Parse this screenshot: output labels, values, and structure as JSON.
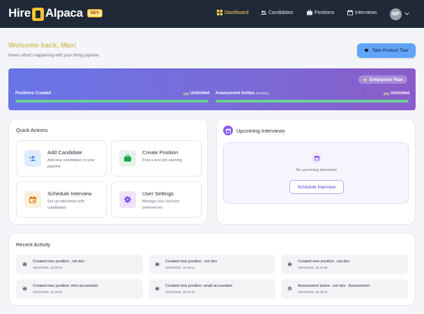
{
  "nav": {
    "logo_left": "Hire",
    "logo_right": "Alpaca",
    "env_badge": "DEV",
    "items": [
      {
        "label": "Dashboard",
        "icon": "dashboard-icon",
        "active": true
      },
      {
        "label": "Candidates",
        "icon": "users-icon",
        "active": false
      },
      {
        "label": "Positions",
        "icon": "briefcase-icon",
        "active": false
      },
      {
        "label": "Interviews",
        "icon": "calendar-icon",
        "active": false
      }
    ],
    "user_initials": "MP"
  },
  "header": {
    "welcome": "Welcome back, Max!",
    "subtitle": "Here's what's happening with your hiring pipeline",
    "tour_button": "Take Product Tour"
  },
  "usage": {
    "plan": "Enterprise Plan",
    "positions_label": "Positions Created",
    "positions_value": "Unlimited",
    "positions_fill": 1.0,
    "invites_label": "Assessment Invites",
    "invites_period": "(Monthly)",
    "invites_value": "Unlimited",
    "invites_fill": 1.0
  },
  "quick_actions": {
    "title": "Quick Actions",
    "items": [
      {
        "title": "Add Candidate",
        "desc": "Add new candidates to your pipeline",
        "icon": "add-user-icon"
      },
      {
        "title": "Create Position",
        "desc": "Post a new job opening",
        "icon": "briefcase-icon"
      },
      {
        "title": "Schedule Interview",
        "desc": "Set up interviews with candidates",
        "icon": "calendar-icon"
      },
      {
        "title": "User Settings",
        "desc": "Manage your account preferences",
        "icon": "gear-icon"
      }
    ]
  },
  "upcoming": {
    "title": "Upcoming Interviews",
    "empty_text": "No upcoming interviews",
    "button": "Schedule Interview"
  },
  "activity": {
    "title": "Recent Activity",
    "items": [
      {
        "text": "Created new position: .net dev",
        "time": "18/02/2026, 18:29:18",
        "icon": "briefcase-icon"
      },
      {
        "text": "Created new position: .net dev",
        "time": "18/02/2026, 18:26:11",
        "icon": "briefcase-icon"
      },
      {
        "text": "Created new position: .net dev",
        "time": "18/02/2026, 18:20:28",
        "icon": "briefcase-icon"
      },
      {
        "text": "Created new position: mini accountant",
        "time": "25/01/2026, 21:18:26",
        "icon": "briefcase-icon"
      },
      {
        "text": "Created new position: small accountant",
        "time": "25/01/2026, 20:03:45",
        "icon": "briefcase-icon"
      },
      {
        "text": "Assessment active: .net dev - Assessment",
        "time": "18/02/2026, 18:28:40",
        "icon": "check-icon"
      }
    ]
  },
  "colors": {
    "nav_bg": "#1f2937",
    "active_nav": "#fcd34d",
    "welcome": "#d4c26a",
    "tour_button": "#60a5fa",
    "usage_fill": "#6bcf98",
    "accent_purple": "#8b5cf6"
  }
}
